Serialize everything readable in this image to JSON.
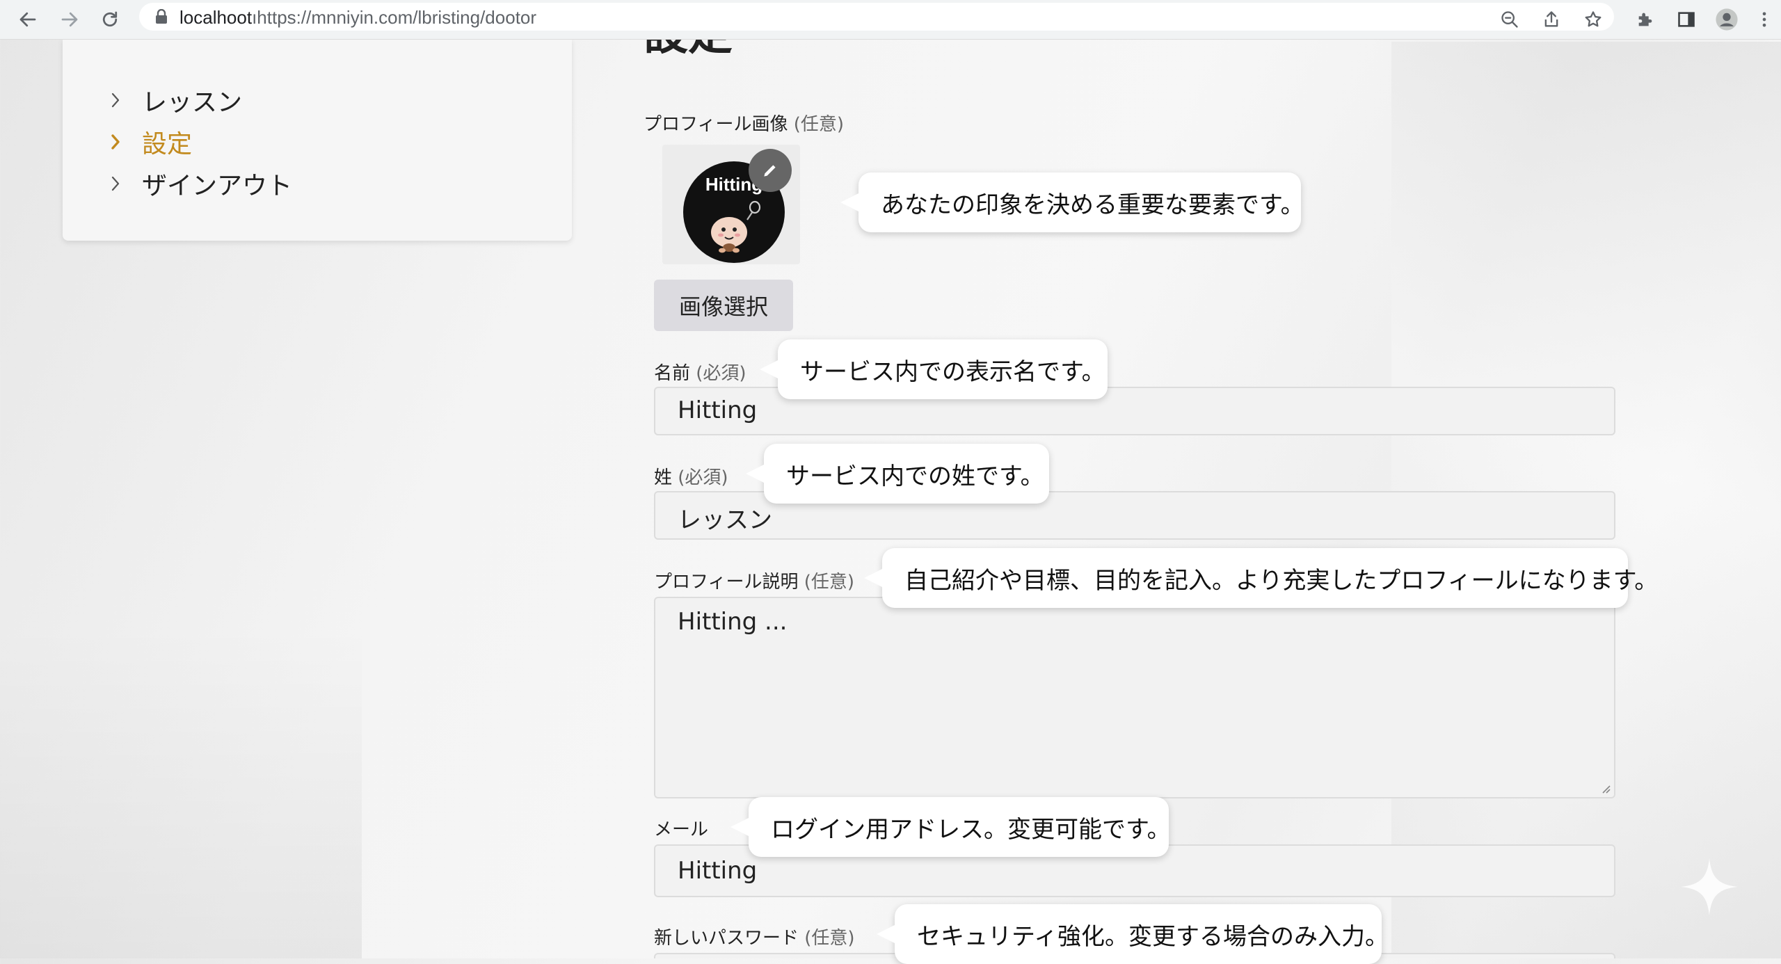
{
  "browser": {
    "url_host": "localhoot",
    "url_rest": "ıhttps://mnniyin.com/lbristing/dootor"
  },
  "sidebar": {
    "items": [
      {
        "label": "レッスン",
        "active": false
      },
      {
        "label": "設定",
        "active": true
      },
      {
        "label": "ザインアウト",
        "active": false
      }
    ]
  },
  "page": {
    "title": "設定"
  },
  "profile_image": {
    "label": "プロフィール画像",
    "optional": "(任意)",
    "avatar_text": "Hitting",
    "tooltip": "あなたの印象を決める重要な要素です。",
    "select_button": "画像選択"
  },
  "name_field": {
    "label": "名前",
    "required": "(必須)",
    "value": "Hitting",
    "tooltip": "サービス内での表示名です。"
  },
  "surname_field": {
    "label": "姓",
    "required": "(必須)",
    "value": "レッスン",
    "tooltip": "サービス内での姓です。"
  },
  "description_field": {
    "label": "プロフィール説明",
    "optional": "(任意)",
    "value": "Hitting ...",
    "tooltip": "自己紹介や目標、目的を記入。より充実したプロフィールになります。"
  },
  "email_field": {
    "label": "メール",
    "value": "Hitting",
    "tooltip": "ログイン用アドレス。変更可能です。"
  },
  "password_field": {
    "label": "新しいパスワード",
    "optional": "(任意)",
    "tooltip": "セキュリティ強化。変更する場合のみ入力。"
  },
  "colors": {
    "active_nav": "#c28a1e",
    "bubble_bg": "#ffffff",
    "button_bg": "#dcdbe0"
  }
}
